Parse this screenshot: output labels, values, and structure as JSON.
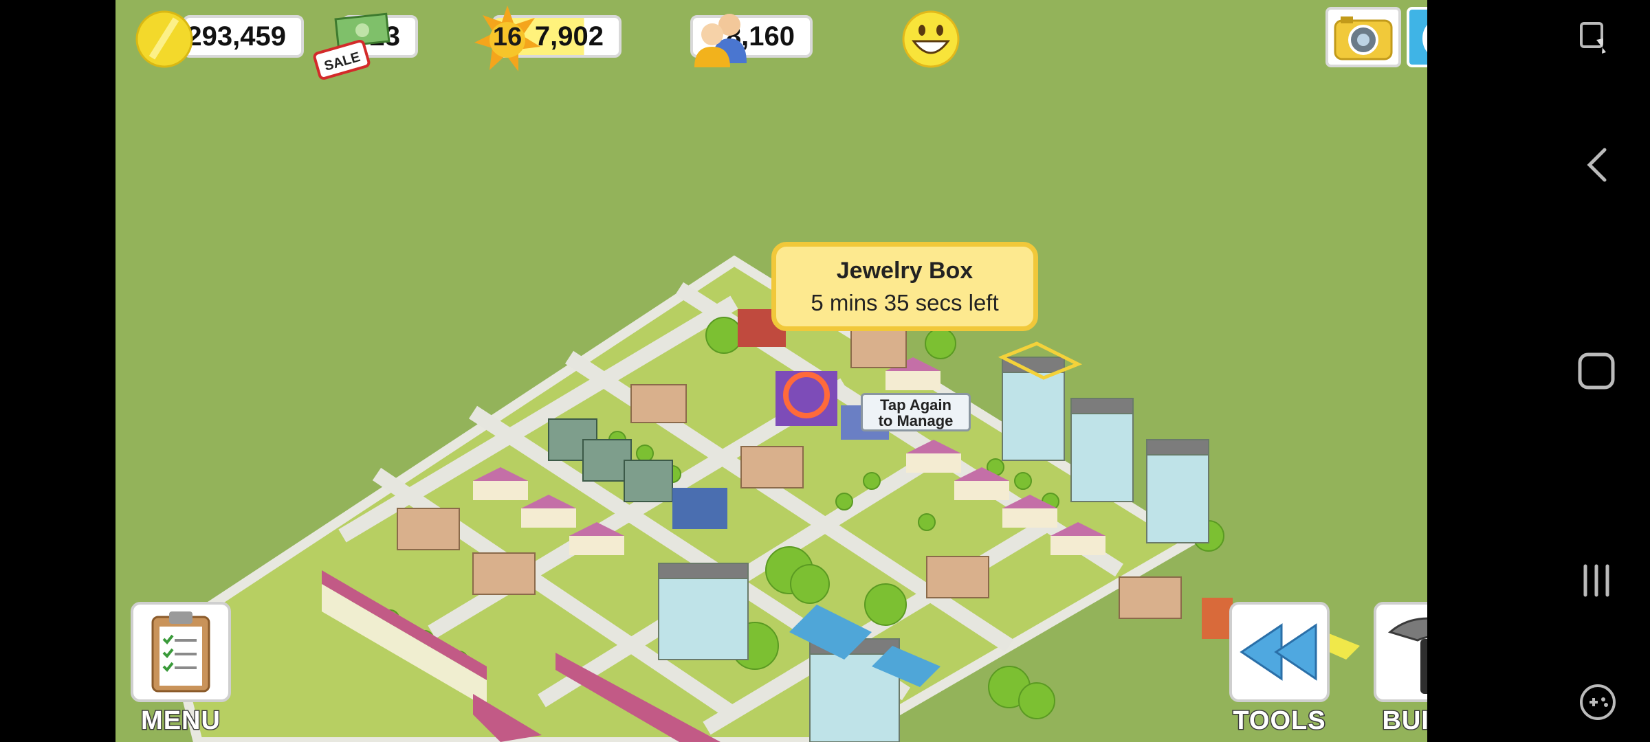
{
  "hud": {
    "coins": "293,459",
    "cash": "23",
    "sale_tag": "SALE",
    "level": "16",
    "xp": "7,902",
    "xp_progress": 0.72,
    "population": "8,160",
    "happiness_icon": "smiley-face-icon"
  },
  "tooltip": {
    "title": "Jewelry Box",
    "time_left": "5 mins 35 secs left"
  },
  "manage_sign": {
    "line1": "Tap Again",
    "line2": "to Manage"
  },
  "buttons": {
    "menu": "MENU",
    "tools": "TOOLS",
    "build": "BUILD"
  },
  "icons": {
    "camera": "camera-icon",
    "share": "share-icon",
    "menu": "clipboard-icon",
    "tools": "rewind-arrows-icon",
    "build": "hammer-icon"
  },
  "system_nav": [
    "screen-pin-icon",
    "back-icon",
    "home-icon",
    "recents-icon",
    "game-tools-icon"
  ],
  "colors": {
    "grass": "#93b35a",
    "tooltip_bg": "#fde98f",
    "tooltip_border": "#f1c83a",
    "share_button": "#3fb4e6"
  }
}
